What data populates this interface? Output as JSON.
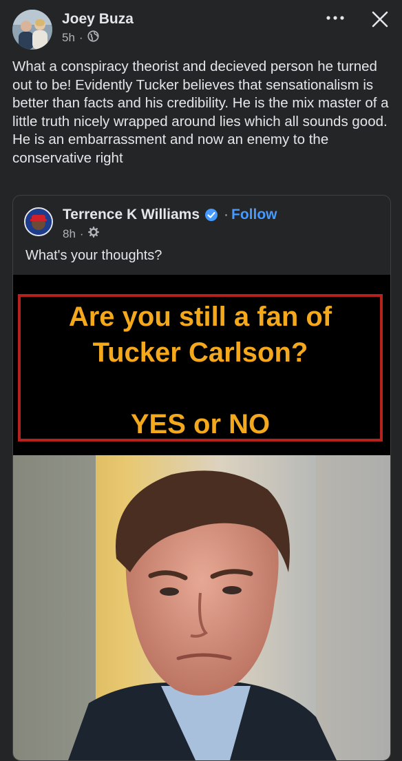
{
  "post": {
    "author_name": "Joey Buza",
    "time": "5h",
    "separator": "·",
    "privacy_icon": "globe-icon",
    "more_icon": "more-options-icon",
    "close_icon": "close-icon",
    "text": "What a conspiracy theorist and decieved person he turned out to be!  Evidently Tucker believes that sensationalism is better than facts and his credibility. He is the mix master of a little truth nicely wrapped around lies which all sounds good. He is an embarrassment and now an enemy to the conservative right"
  },
  "shared": {
    "author_name": "Terrence K Williams",
    "verified_icon": "verified-badge-icon",
    "separator": "·",
    "follow_label": "Follow",
    "time": "8h",
    "audience_icon": "gear-icon",
    "text": "What's your thoughts?",
    "banner": {
      "line1": "Are you still a fan of",
      "line2": "Tucker Carlson?",
      "line3": "YES or NO"
    }
  },
  "colors": {
    "background": "#242526",
    "text": "#e4e6eb",
    "muted": "#b0b3b8",
    "link": "#4599ff",
    "banner_text": "#f4a81c",
    "banner_border": "#b5221e"
  }
}
